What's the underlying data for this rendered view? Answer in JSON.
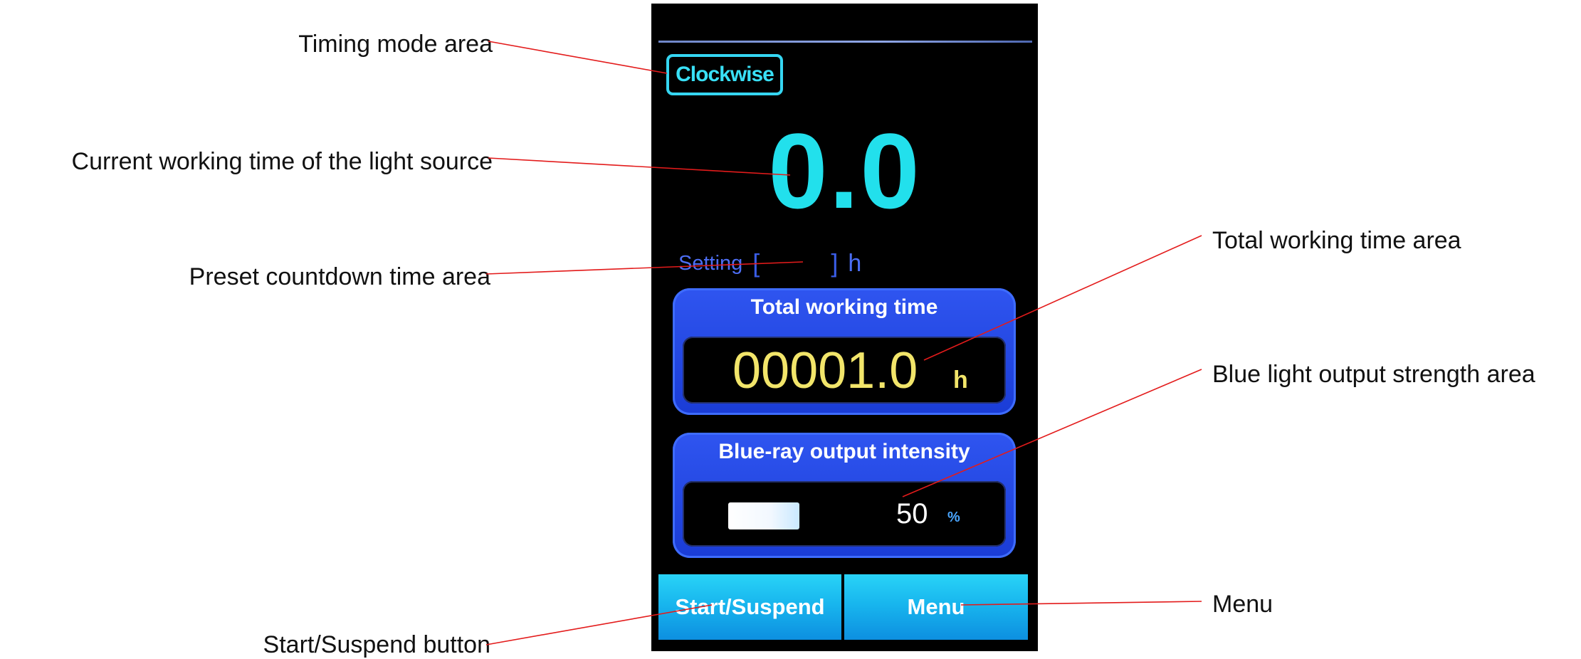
{
  "annotations": {
    "timing_mode": "Timing mode area",
    "current_time": "Current working time of the light source",
    "preset_countdown": "Preset countdown time area",
    "start_suspend": "Start/Suspend button",
    "total_working": "Total working time area",
    "blue_output": "Blue light output strength area",
    "menu": "Menu"
  },
  "screen": {
    "timing_mode_button": "Clockwise",
    "current_time": "0.0",
    "setting": {
      "label": "Setting",
      "open_bracket": "[",
      "close_bracket": "]",
      "unit": "h"
    },
    "total_working": {
      "title": "Total working time",
      "value": "00001.0",
      "unit": "h"
    },
    "intensity": {
      "title": "Blue-ray output intensity",
      "value": "50",
      "unit": "%",
      "level_fraction": 0.5
    },
    "buttons": {
      "start_suspend": "Start/Suspend",
      "menu": "Menu"
    }
  },
  "colors": {
    "screen_bg": "#000000",
    "cyan_accent": "#22e0ec",
    "panel_blue": "#1f44e0",
    "total_value_yellow": "#f2e56a",
    "button_blue": "#18b6ee",
    "leader_line": "#e31b1b"
  }
}
